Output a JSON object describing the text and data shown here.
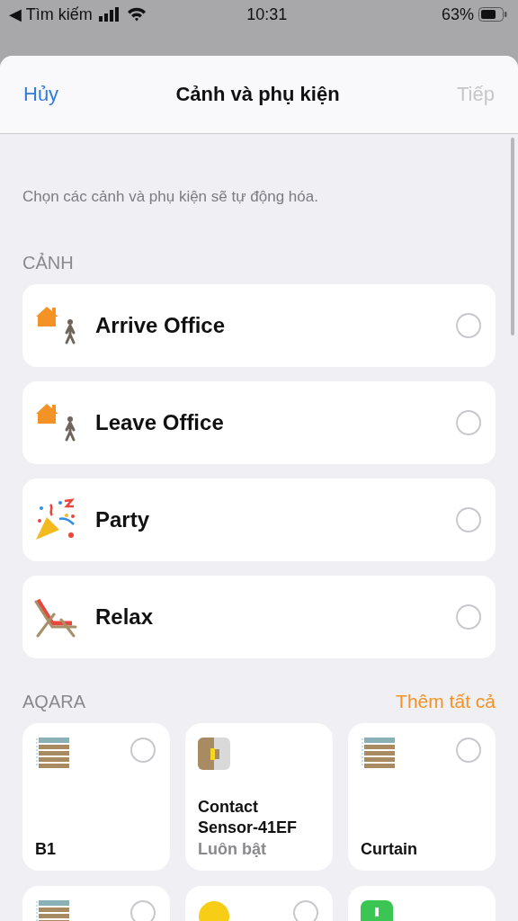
{
  "status_bar": {
    "back_label": "◀ Tìm kiếm",
    "time": "10:31",
    "battery": "63%"
  },
  "sheet": {
    "cancel": "Hủy",
    "title": "Cảnh và phụ kiện",
    "next": {
      "label": "Tiếp",
      "disabled": true
    }
  },
  "description": "Chọn các cảnh và phụ kiện sẽ tự động hóa.",
  "scenes_header": "CẢNH",
  "scenes": [
    {
      "name": "Arrive Office",
      "kind": "arrive",
      "selected": false
    },
    {
      "name": "Leave Office",
      "kind": "leave",
      "selected": false
    },
    {
      "name": "Party",
      "kind": "party",
      "selected": false
    },
    {
      "name": "Relax",
      "kind": "relax",
      "selected": false
    }
  ],
  "accessories_header": "AQARA",
  "add_all": "Thêm tất cả",
  "accessories": [
    {
      "name": "B1",
      "kind": "blind",
      "selected": false
    },
    {
      "name": "Contact Sensor-41EF",
      "status": "Luôn bật",
      "kind": "sensor"
    },
    {
      "name": "Curtain",
      "kind": "blind",
      "selected": false
    },
    {
      "kind": "blind",
      "selected": false
    },
    {
      "kind": "bulb",
      "selected": false
    },
    {
      "kind": "outlet"
    }
  ]
}
